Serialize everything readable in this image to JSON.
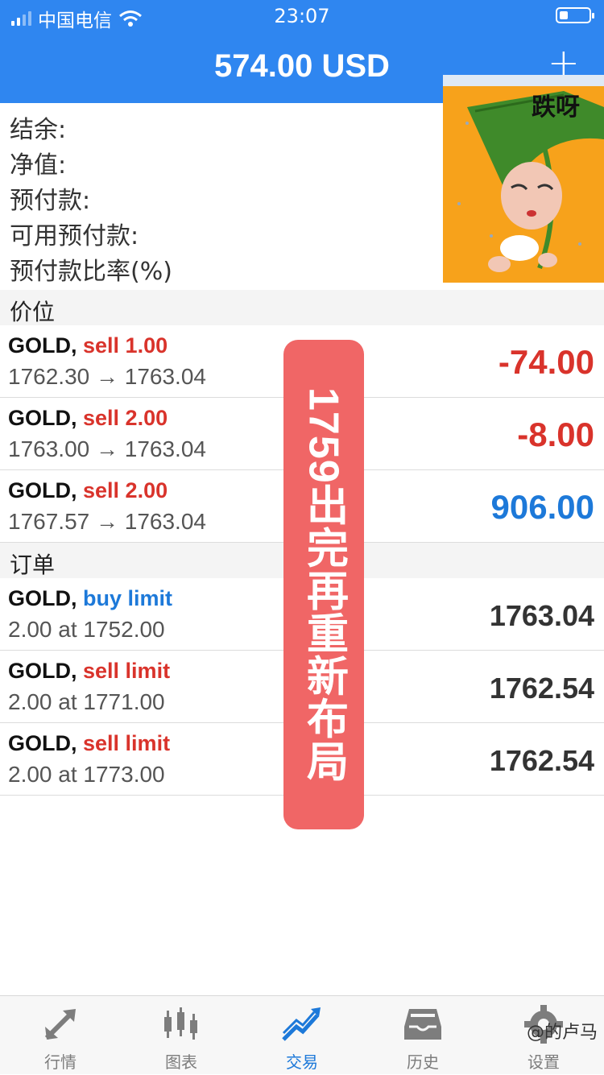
{
  "status": {
    "carrier": "中国电信",
    "time": "23:07"
  },
  "nav": {
    "title": "574.00 USD",
    "add": "+"
  },
  "summary": {
    "balance": "结余:",
    "equity": "净值:",
    "margin": "预付款:",
    "free_margin": "可用预付款:",
    "margin_level": "预付款比率(%)"
  },
  "sticker": {
    "text": "跌呀"
  },
  "positions": {
    "header": "价位",
    "items": [
      {
        "symbol": "GOLD,",
        "side": "sell 1.00",
        "prices": "1762.30 → 1763.04",
        "profit": "-74.00"
      },
      {
        "symbol": "GOLD,",
        "side": "sell 2.00",
        "prices": "1763.00 → 1763.04",
        "profit": "-8.00"
      },
      {
        "symbol": "GOLD,",
        "side": "sell 2.00",
        "prices": "1767.57 → 1763.04",
        "profit": "906.00"
      }
    ]
  },
  "orders": {
    "header": "订单",
    "items": [
      {
        "symbol": "GOLD,",
        "type": "buy limit",
        "detail": "2.00 at 1752.00",
        "price": "1763.04"
      },
      {
        "symbol": "GOLD,",
        "type": "sell limit",
        "detail": "2.00 at 1771.00",
        "price": "1762.54"
      },
      {
        "symbol": "GOLD,",
        "type": "sell limit",
        "detail": "2.00 at 1773.00",
        "price": "1762.54"
      }
    ]
  },
  "overlay": {
    "text": "1759出完再重新布局"
  },
  "tabs": [
    {
      "label": "行情",
      "icon": "quotes-arrows-icon"
    },
    {
      "label": "图表",
      "icon": "candlestick-chart-icon"
    },
    {
      "label": "交易",
      "icon": "trade-trend-icon"
    },
    {
      "label": "历史",
      "icon": "history-tray-icon"
    },
    {
      "label": "设置",
      "icon": "gear-icon"
    }
  ],
  "watermark": "@的卢马",
  "colors": {
    "brand": "#2f86f0",
    "loss": "#d9332b",
    "profit": "#1d79d9",
    "overlay": "#f06666"
  }
}
